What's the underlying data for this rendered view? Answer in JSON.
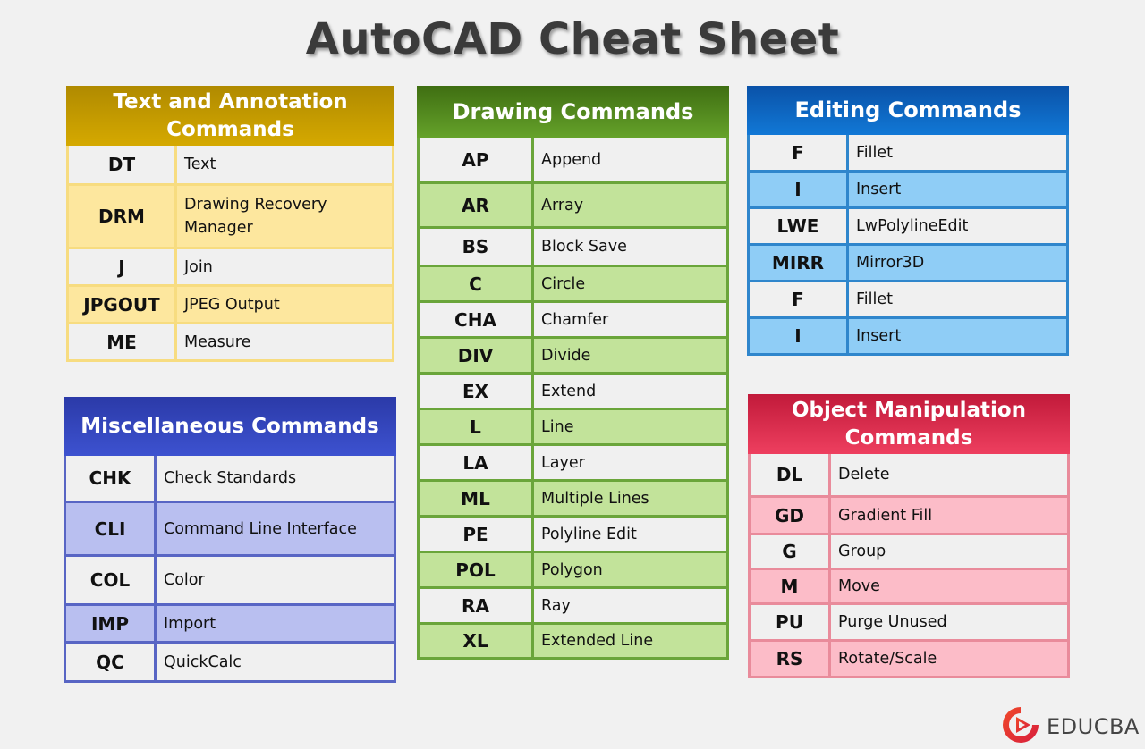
{
  "title": "AutoCAD Cheat Sheet",
  "brand": {
    "name": "EDUCBA",
    "logo_icon": "educba-logo-icon",
    "accent": "#e8362b"
  },
  "colors": {
    "text_annotation": "#c9a000",
    "drawing": "#5a9323",
    "editing": "#0f6ec6",
    "miscellaneous": "#3447c0",
    "object_manipulation": "#de2f50"
  },
  "panels": {
    "text_annotation": {
      "title": "Text and Annotation Commands",
      "rows": [
        {
          "cmd": "DT",
          "desc": "Text"
        },
        {
          "cmd": "DRM",
          "desc": "Drawing Recovery Manager"
        },
        {
          "cmd": "J",
          "desc": "Join"
        },
        {
          "cmd": "JPGOUT",
          "desc": "JPEG Output"
        },
        {
          "cmd": "ME",
          "desc": "Measure"
        }
      ]
    },
    "drawing": {
      "title": "Drawing Commands",
      "rows": [
        {
          "cmd": "AP",
          "desc": "Append"
        },
        {
          "cmd": "AR",
          "desc": "Array"
        },
        {
          "cmd": "BS",
          "desc": "Block Save"
        },
        {
          "cmd": "C",
          "desc": "Circle"
        },
        {
          "cmd": "CHA",
          "desc": "Chamfer"
        },
        {
          "cmd": "DIV",
          "desc": "Divide"
        },
        {
          "cmd": "EX",
          "desc": "Extend"
        },
        {
          "cmd": "L",
          "desc": "Line"
        },
        {
          "cmd": "LA",
          "desc": "Layer"
        },
        {
          "cmd": "ML",
          "desc": "Multiple Lines"
        },
        {
          "cmd": "PE",
          "desc": "Polyline Edit"
        },
        {
          "cmd": "POL",
          "desc": "Polygon"
        },
        {
          "cmd": "RA",
          "desc": "Ray"
        },
        {
          "cmd": "XL",
          "desc": "Extended Line"
        }
      ]
    },
    "editing": {
      "title": "Editing Commands",
      "rows": [
        {
          "cmd": "F",
          "desc": "Fillet"
        },
        {
          "cmd": "I",
          "desc": "Insert"
        },
        {
          "cmd": "LWE",
          "desc": "LwPolylineEdit"
        },
        {
          "cmd": "MIRR",
          "desc": "Mirror3D"
        },
        {
          "cmd": "F",
          "desc": "Fillet"
        },
        {
          "cmd": "I",
          "desc": "Insert"
        }
      ]
    },
    "miscellaneous": {
      "title": "Miscellaneous Commands",
      "rows": [
        {
          "cmd": "CHK",
          "desc": "Check Standards"
        },
        {
          "cmd": "CLI",
          "desc": "Command Line Interface"
        },
        {
          "cmd": "COL",
          "desc": "Color"
        },
        {
          "cmd": "IMP",
          "desc": "Import"
        },
        {
          "cmd": "QC",
          "desc": "QuickCalc"
        }
      ]
    },
    "object_manipulation": {
      "title": "Object Manipulation Commands",
      "rows": [
        {
          "cmd": "DL",
          "desc": "Delete"
        },
        {
          "cmd": "GD",
          "desc": "Gradient Fill"
        },
        {
          "cmd": "G",
          "desc": "Group"
        },
        {
          "cmd": "M",
          "desc": "Move"
        },
        {
          "cmd": "PU",
          "desc": "Purge Unused"
        },
        {
          "cmd": "RS",
          "desc": "Rotate/Scale"
        }
      ]
    }
  }
}
